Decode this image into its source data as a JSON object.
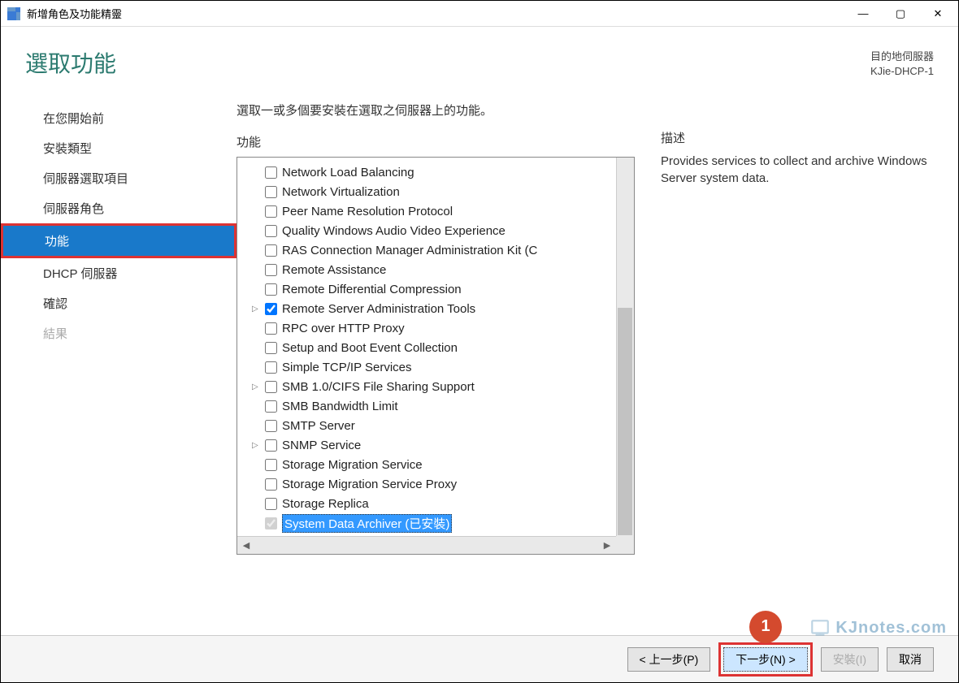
{
  "window": {
    "title": "新增角色及功能精靈",
    "minimize": "—",
    "maximize": "▢",
    "close": "✕"
  },
  "header": {
    "title": "選取功能",
    "dest_label": "目的地伺服器",
    "dest_value": "KJie-DHCP-1"
  },
  "sidebar": {
    "items": [
      {
        "label": "在您開始前"
      },
      {
        "label": "安裝類型"
      },
      {
        "label": "伺服器選取項目"
      },
      {
        "label": "伺服器角色"
      },
      {
        "label": "功能"
      },
      {
        "label": "DHCP 伺服器"
      },
      {
        "label": "確認"
      },
      {
        "label": "結果"
      }
    ],
    "selected_index": 4,
    "disabled_index": 7
  },
  "instruction": "選取一或多個要安裝在選取之伺服器上的功能。",
  "features_label": "功能",
  "features": [
    {
      "label": "Network Load Balancing",
      "checked": false
    },
    {
      "label": "Network Virtualization",
      "checked": false
    },
    {
      "label": "Peer Name Resolution Protocol",
      "checked": false
    },
    {
      "label": "Quality Windows Audio Video Experience",
      "checked": false
    },
    {
      "label": "RAS Connection Manager Administration Kit (C",
      "checked": false
    },
    {
      "label": "Remote Assistance",
      "checked": false
    },
    {
      "label": "Remote Differential Compression",
      "checked": false
    },
    {
      "label": "Remote Server Administration Tools",
      "checked": true,
      "expandable": true
    },
    {
      "label": "RPC over HTTP Proxy",
      "checked": false
    },
    {
      "label": "Setup and Boot Event Collection",
      "checked": false
    },
    {
      "label": "Simple TCP/IP Services",
      "checked": false
    },
    {
      "label": "SMB 1.0/CIFS File Sharing Support",
      "checked": false,
      "expandable": true
    },
    {
      "label": "SMB Bandwidth Limit",
      "checked": false
    },
    {
      "label": "SMTP Server",
      "checked": false
    },
    {
      "label": "SNMP Service",
      "checked": false,
      "expandable": true
    },
    {
      "label": "Storage Migration Service",
      "checked": false
    },
    {
      "label": "Storage Migration Service Proxy",
      "checked": false
    },
    {
      "label": "Storage Replica",
      "checked": false
    },
    {
      "label": "System Data Archiver (已安裝)",
      "checked": true,
      "installed": true,
      "selected": true
    }
  ],
  "description": {
    "label": "描述",
    "text": "Provides services to collect and archive Windows Server system data."
  },
  "buttons": {
    "previous": "< 上一步(P)",
    "next": "下一步(N) >",
    "install": "安裝(I)",
    "cancel": "取消"
  },
  "annotation": {
    "badge": "1"
  },
  "watermark": "KJnotes.com"
}
